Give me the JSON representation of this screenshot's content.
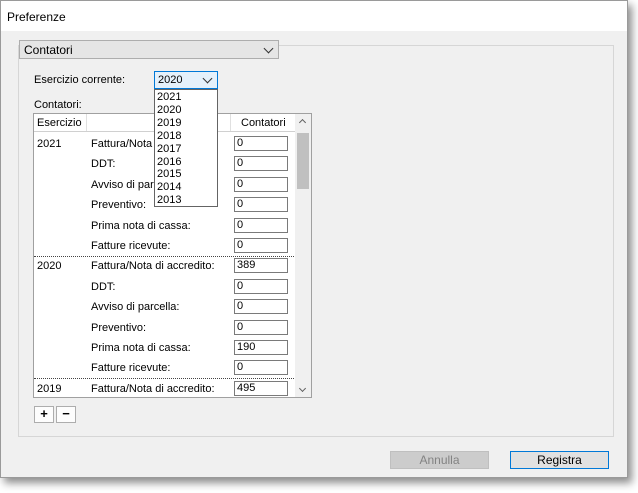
{
  "window": {
    "title": "Preferenze"
  },
  "section_select": {
    "value": "Contatori"
  },
  "current_year": {
    "label": "Esercizio corrente:",
    "value": "2020"
  },
  "table": {
    "caption": "Contatori:",
    "headers": {
      "year": "Esercizio",
      "counters": "Contatori"
    },
    "rows": [
      {
        "year": "2021",
        "label": "Fattura/Nota di accredito:",
        "value": "0"
      },
      {
        "year": "",
        "label": "DDT:",
        "value": "0"
      },
      {
        "year": "",
        "label": "Avviso di parcella:",
        "value": "0"
      },
      {
        "year": "",
        "label": "Preventivo:",
        "value": "0"
      },
      {
        "year": "",
        "label": "Prima nota di cassa:",
        "value": "0"
      },
      {
        "year": "",
        "label": "Fatture ricevute:",
        "value": "0"
      },
      {
        "year": "2020",
        "label": "Fattura/Nota di accredito:",
        "value": "389"
      },
      {
        "year": "",
        "label": "DDT:",
        "value": "0"
      },
      {
        "year": "",
        "label": "Avviso di parcella:",
        "value": "0"
      },
      {
        "year": "",
        "label": "Preventivo:",
        "value": "0"
      },
      {
        "year": "",
        "label": "Prima nota di cassa:",
        "value": "190"
      },
      {
        "year": "",
        "label": "Fatture ricevute:",
        "value": "0"
      },
      {
        "year": "2019",
        "label": "Fattura/Nota di accredito:",
        "value": "495"
      }
    ]
  },
  "year_dropdown": {
    "options": [
      "2021",
      "2020",
      "2019",
      "2018",
      "2017",
      "2016",
      "2015",
      "2014",
      "2013"
    ]
  },
  "buttons": {
    "add": "+",
    "remove": "−",
    "cancel": "Annulla",
    "save": "Registra"
  },
  "colors": {
    "accent": "#0078d7",
    "window_bg": "#f0f0f0"
  }
}
